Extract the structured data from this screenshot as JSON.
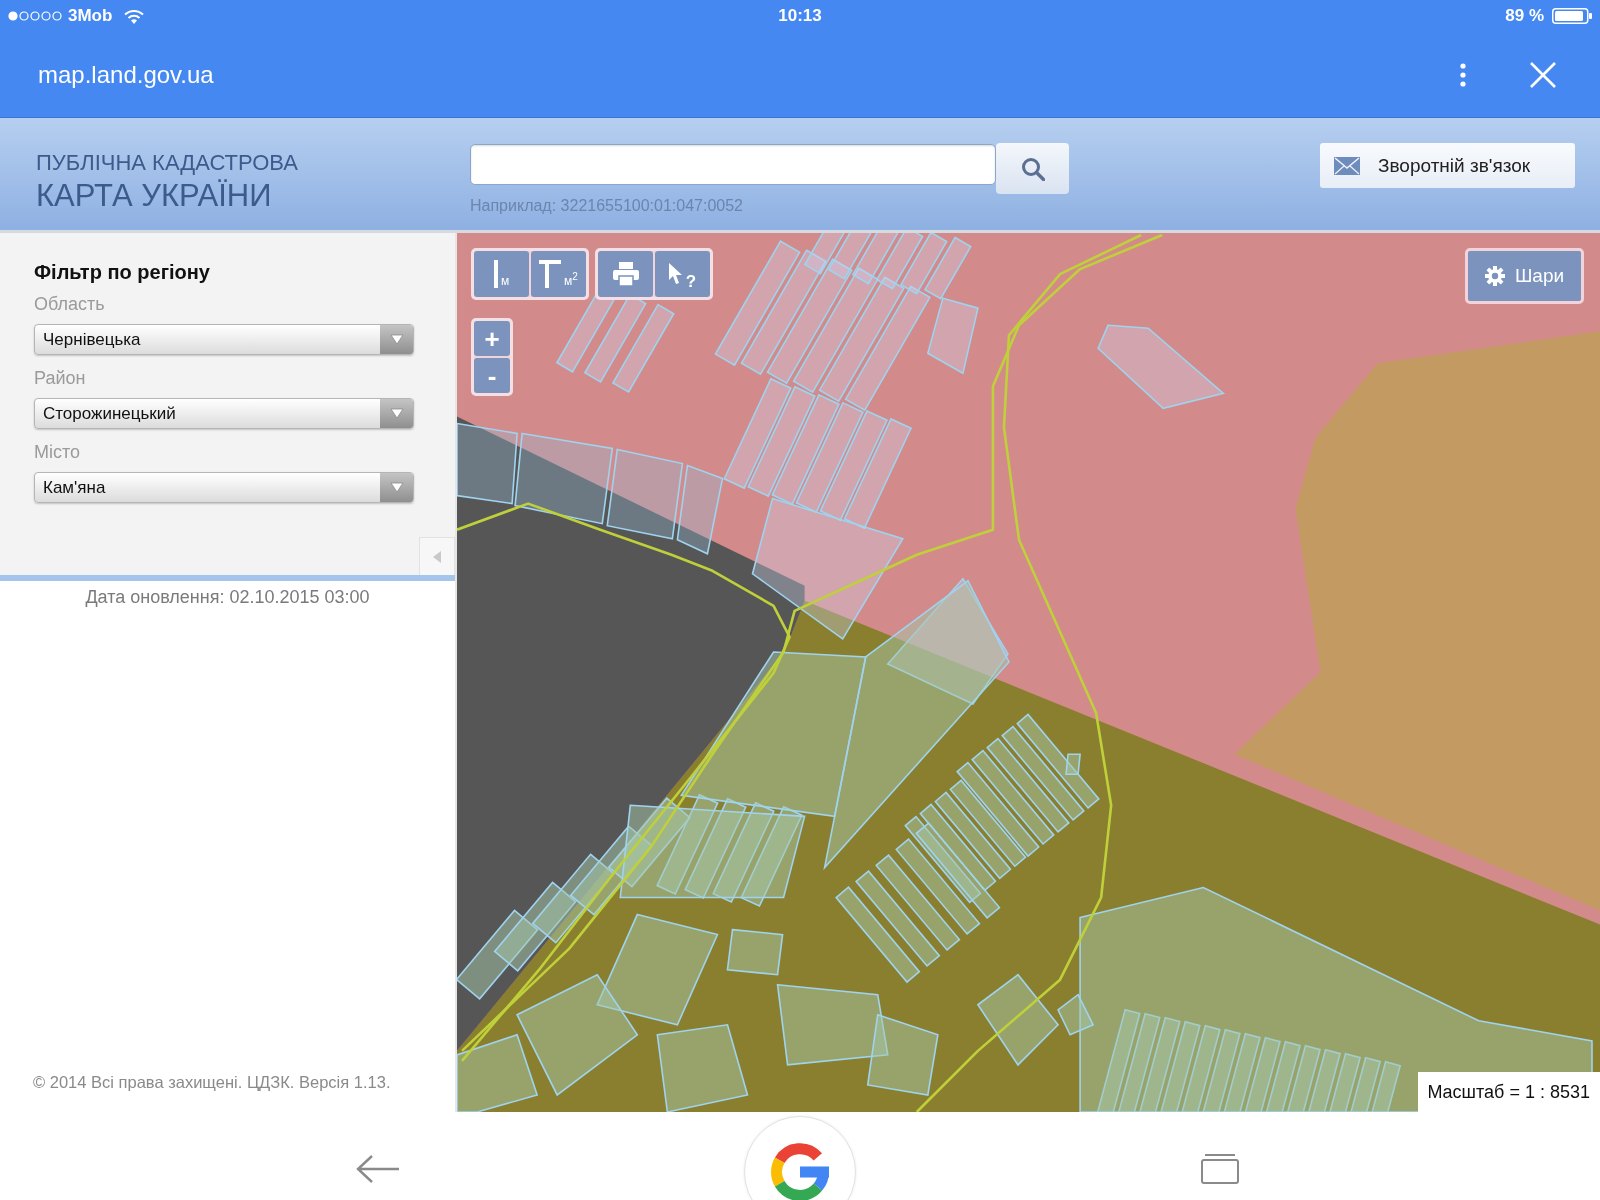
{
  "status_bar": {
    "carrier": "3Mob",
    "time": "10:13",
    "battery": "89 %"
  },
  "browser_bar": {
    "url": "map.land.gov.ua"
  },
  "header": {
    "title_lines": [
      "ПУБЛІЧНА КАДАСТРОВА",
      "КАРТА УКРАЇНИ"
    ],
    "search": {
      "hint": "Наприклад: 3221655100:01:047:0052"
    },
    "feedback_button": "Зворотній зв'язок"
  },
  "sidebar": {
    "heading": "Фільтр по регіону",
    "filters": [
      {
        "label": "Область",
        "value": "Чернівецька"
      },
      {
        "label": "Район",
        "value": "Сторожинецький"
      },
      {
        "label": "Місто",
        "value": "Кам'яна"
      }
    ],
    "update_date": "Дата оновлення: 02.10.2015 03:00",
    "footer": "© 2014 Всі права захищені. ЦДЗК. Версія 1.13."
  },
  "map": {
    "tool_groups": [
      [
        {
          "kind": "distance",
          "label": "м"
        },
        {
          "kind": "area",
          "label": "м$^{2}$"
        }
      ],
      [
        {
          "kind": "print"
        },
        {
          "kind": "identify",
          "label": "?"
        }
      ]
    ],
    "zoom_buttons": [
      "+",
      "-"
    ],
    "layers_button": "Шари",
    "scale": "Масштаб = 1 : 8531"
  }
}
